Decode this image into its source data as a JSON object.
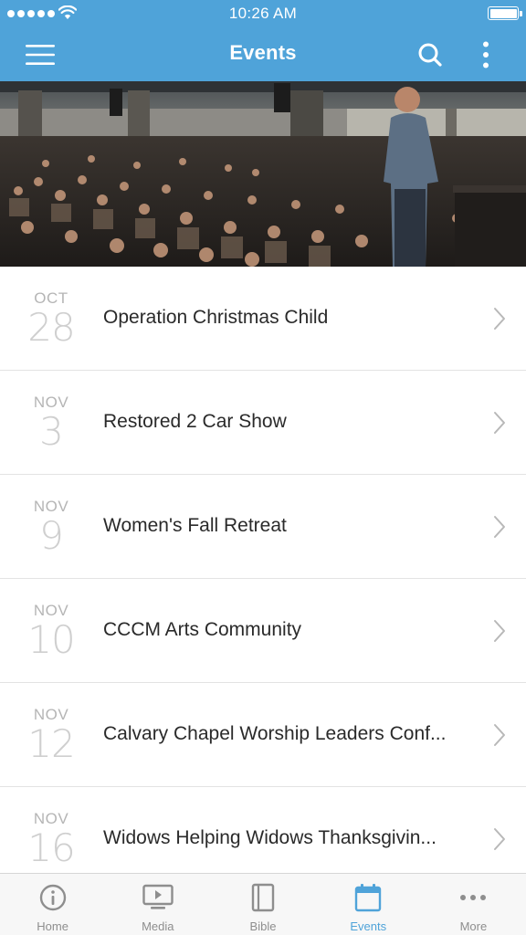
{
  "status_bar": {
    "time": "10:26 AM",
    "signal_icon": "signal-dots-icon",
    "wifi_icon": "wifi-icon",
    "battery_icon": "battery-icon"
  },
  "nav_bar": {
    "title": "Events",
    "menu_icon": "hamburger-menu-icon",
    "search_icon": "search-icon",
    "more_icon": "vertical-ellipsis-icon",
    "background_color": "#4fa3d9"
  },
  "hero": {
    "description": "speaker-on-stage-audience-photo"
  },
  "events": [
    {
      "month": "OCT",
      "day": "28",
      "title": "Operation Christmas Child"
    },
    {
      "month": "NOV",
      "day": "3",
      "title": "Restored 2 Car Show"
    },
    {
      "month": "NOV",
      "day": "9",
      "title": "Women's Fall Retreat"
    },
    {
      "month": "NOV",
      "day": "10",
      "title": "CCCM Arts Community"
    },
    {
      "month": "NOV",
      "day": "12",
      "title": "Calvary Chapel Worship Leaders Conf..."
    },
    {
      "month": "NOV",
      "day": "16",
      "title": "Widows Helping Widows Thanksgivin..."
    }
  ],
  "tab_bar": {
    "tabs": [
      {
        "label": "Home",
        "icon": "info-circle-icon",
        "active": false
      },
      {
        "label": "Media",
        "icon": "play-screen-icon",
        "active": false
      },
      {
        "label": "Bible",
        "icon": "book-icon",
        "active": false
      },
      {
        "label": "Events",
        "icon": "calendar-icon",
        "active": true
      },
      {
        "label": "More",
        "icon": "horizontal-ellipsis-icon",
        "active": false
      }
    ],
    "active_color": "#4fa3d9",
    "inactive_color": "#8e8e8e"
  }
}
